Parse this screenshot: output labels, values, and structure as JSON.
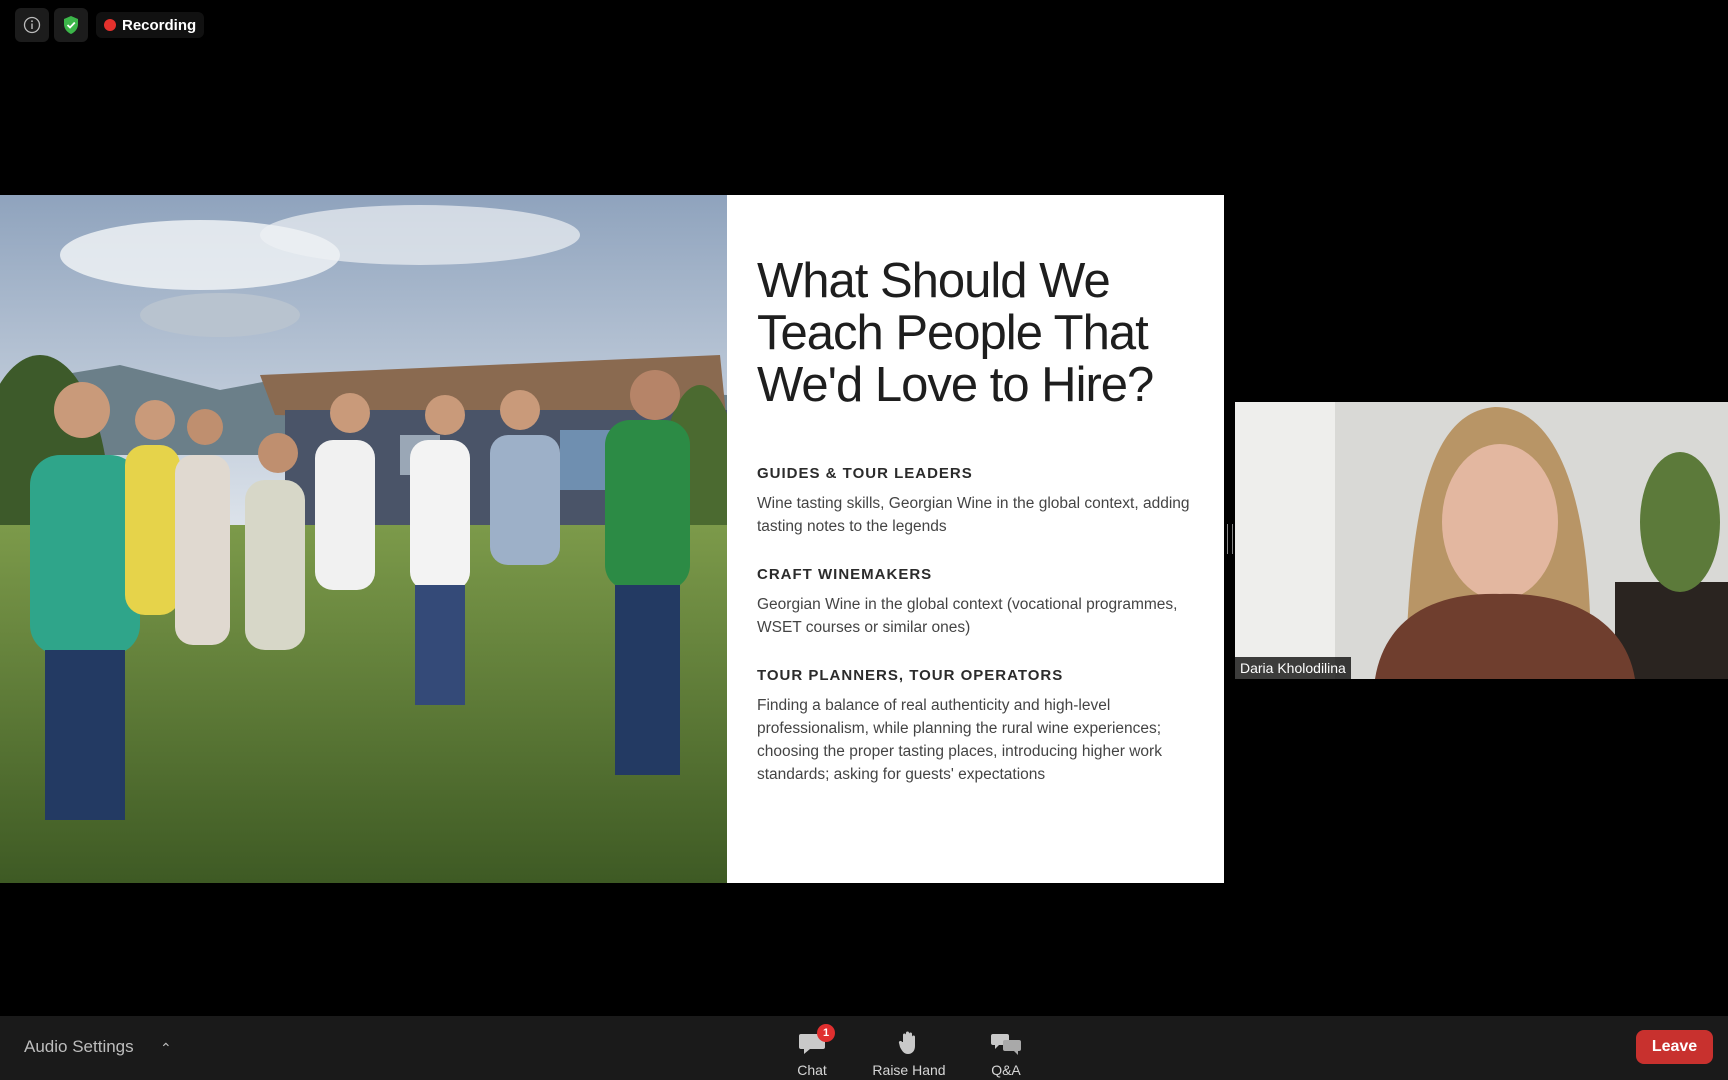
{
  "status": {
    "recording_label": "Recording"
  },
  "slide": {
    "title": "What Should We\nTeach People That\nWe'd Love to Hire?",
    "sections": [
      {
        "heading": "GUIDES & TOUR LEADERS",
        "body": "Wine tasting skills, Georgian Wine in the global context, adding tasting notes to the legends"
      },
      {
        "heading": "CRAFT WINEMAKERS",
        "body": "Georgian Wine in the global context (vocational programmes, WSET courses or similar ones)"
      },
      {
        "heading": "TOUR PLANNERS, TOUR OPERATORS",
        "body": " Finding a balance of real authenticity and high-level professionalism, while planning the rural wine experiences; choosing the proper tasting places, introducing higher work standards; asking for guests' expectations"
      }
    ]
  },
  "participant": {
    "name": "Daria Kholodilina"
  },
  "toolbar": {
    "audio_settings_label": "Audio Settings",
    "chat_label": "Chat",
    "chat_badge": "1",
    "raise_hand_label": "Raise Hand",
    "qa_label": "Q&A",
    "leave_label": "Leave"
  },
  "colors": {
    "leave": "#c8312e",
    "recording_dot": "#e5312d",
    "shield": "#3cb64a"
  }
}
